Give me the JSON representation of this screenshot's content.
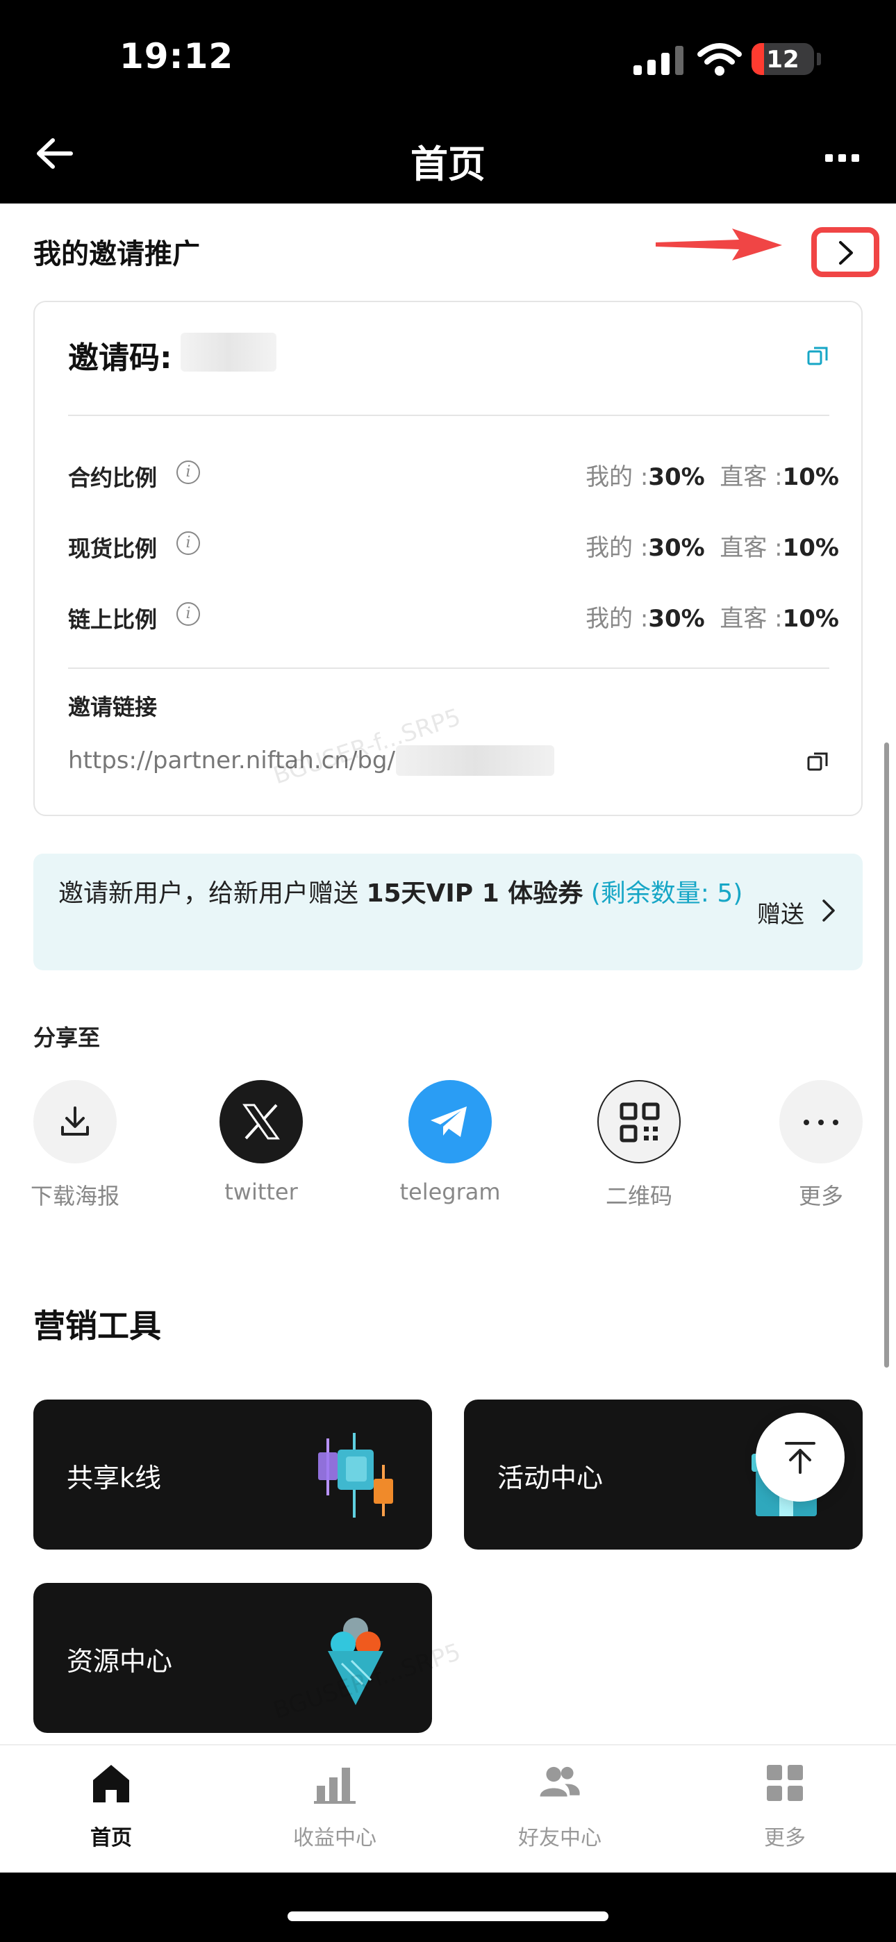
{
  "status_bar": {
    "time": "19:12",
    "battery": "12"
  },
  "nav": {
    "title": "首页"
  },
  "invite": {
    "section_title": "我的邀请推广",
    "code_label": "邀请码:",
    "rows": [
      {
        "label": "合约比例",
        "mine_label": "我的 :",
        "mine": "30%",
        "direct_label": "直客 :",
        "direct": "10%"
      },
      {
        "label": "现货比例",
        "mine_label": "我的 :",
        "mine": "30%",
        "direct_label": "直客 :",
        "direct": "10%"
      },
      {
        "label": "链上比例",
        "mine_label": "我的 :",
        "mine": "30%",
        "direct_label": "直客 :",
        "direct": "10%"
      }
    ],
    "link_label": "邀请链接",
    "link": "https://partner.niftah.cn/bg/",
    "watermark": "BGUSER-f...SRP5"
  },
  "promo": {
    "text": "邀请新用户，给新用户赠送 ",
    "bold": "15天VIP 1 体验券",
    "remaining": " (剩余数量: 5)",
    "action": "赠送"
  },
  "share": {
    "title": "分享至",
    "items": [
      {
        "label": "下载海报",
        "icon": "download-icon"
      },
      {
        "label": "twitter",
        "icon": "x-logo-icon"
      },
      {
        "label": "telegram",
        "icon": "telegram-icon"
      },
      {
        "label": "二维码",
        "icon": "qr-code-icon"
      },
      {
        "label": "更多",
        "icon": "more-icon"
      }
    ]
  },
  "tools": {
    "title": "营销工具",
    "items": [
      {
        "label": "共享k线",
        "icon": "candlestick-icon"
      },
      {
        "label": "活动中心",
        "icon": "gift-icon"
      },
      {
        "label": "资源中心",
        "icon": "ice-cream-icon"
      }
    ]
  },
  "tabbar": {
    "items": [
      {
        "label": "首页",
        "icon": "home-icon",
        "active": true
      },
      {
        "label": "收益中心",
        "icon": "bar-chart-icon"
      },
      {
        "label": "好友中心",
        "icon": "friends-icon"
      },
      {
        "label": "更多",
        "icon": "grid-icon"
      }
    ]
  },
  "colors": {
    "accent": "#16a6c6",
    "highlight_red": "#f04545",
    "telegram_blue": "#2a9df4"
  }
}
